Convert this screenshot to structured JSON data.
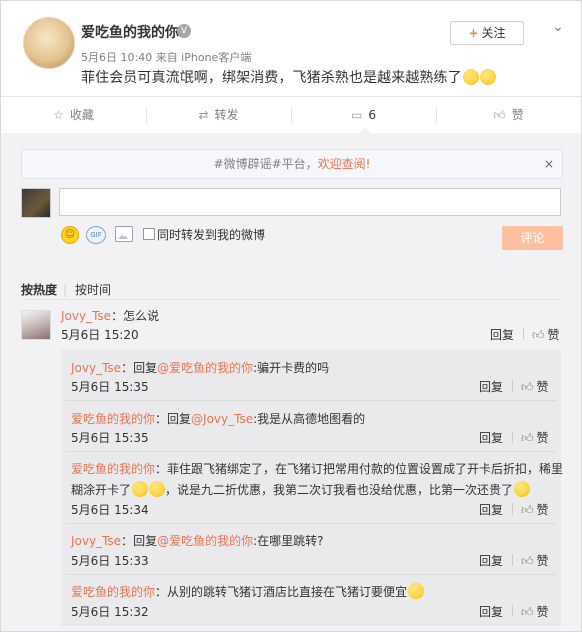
{
  "post": {
    "author": "爱吃鱼的我的你",
    "meta": "5月6日 10:40 来自 iPhone客户端",
    "text": "菲住会员可真流氓啊，绑架消费，飞猪杀熟也是越来越熟练了",
    "follow_label": "关注"
  },
  "actions": {
    "favorite": "收藏",
    "repost": "转发",
    "comment_count": "6",
    "like": "赞"
  },
  "notice": {
    "prefix": "#微博辟谣#平台，",
    "highlight": "欢迎查阅!",
    "close": "×"
  },
  "composer": {
    "input_value": "",
    "repost_checkbox_label": "同时转发到我的微博",
    "submit_label": "评论"
  },
  "sort_tabs": {
    "hot": "按热度",
    "separator": "|",
    "time": "按时间"
  },
  "comment": {
    "author": "Jovy_Tse",
    "text": "：怎么说",
    "time": "5月6日 15:20",
    "reply": "回复",
    "like": "赞"
  },
  "replies": [
    {
      "author": "Jovy_Tse",
      "prefix": "：回复",
      "target": "@爱吃鱼的我的你",
      "text": ":骗开卡费的吗",
      "time": "5月6日 15:35",
      "reply": "回复",
      "like": "赞"
    },
    {
      "author": "爱吃鱼的我的你",
      "prefix": "：回复",
      "target": "@Jovy_Tse",
      "text": ":我是从高德地图看的",
      "time": "5月6日 15:35",
      "reply": "回复",
      "like": "赞"
    },
    {
      "author": "爱吃鱼的我的你",
      "text_line1": "：菲住跟飞猪绑定了，在飞猪订把常用付款的位置设置成了开卡后折扣，稀里",
      "text_line2a": "糊涂开卡了",
      "text_line2b": "，说是九二折优惠，我第二次订我看也没给优惠，比第一次还贵了",
      "time": "5月6日 15:34",
      "reply": "回复",
      "like": "赞"
    },
    {
      "author": "Jovy_Tse",
      "prefix": "：回复",
      "target": "@爱吃鱼的我的你",
      "text": ":在哪里跳转?",
      "time": "5月6日 15:33",
      "reply": "回复",
      "like": "赞"
    },
    {
      "author": "爱吃鱼的我的你",
      "text": "：从别的跳转飞猪订酒店比直接在飞猪订要便宜",
      "time": "5月6日 15:32",
      "reply": "回复",
      "like": "赞"
    }
  ],
  "colors": {
    "name": "#eb7350",
    "link": "#eb7350",
    "submit_bg": "#ffc09f"
  }
}
